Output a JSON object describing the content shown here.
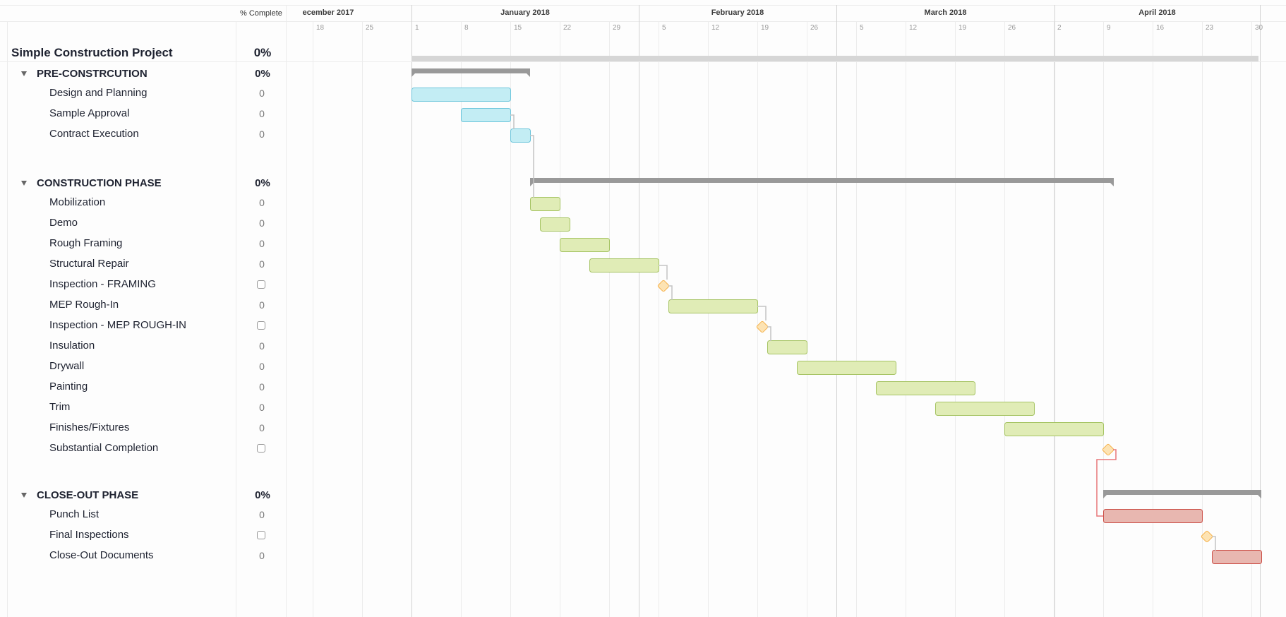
{
  "header": {
    "percent_complete_label": "% Complete",
    "months": [
      "ecember 2017",
      "January 2018",
      "February 2018",
      "March 2018",
      "April 2018"
    ],
    "days": [
      "18",
      "25",
      "1",
      "8",
      "15",
      "22",
      "29",
      "5",
      "12",
      "19",
      "26",
      "5",
      "12",
      "19",
      "26",
      "2",
      "9",
      "16",
      "23",
      "30"
    ]
  },
  "project": {
    "title": "Simple Construction Project",
    "percent": "0%"
  },
  "phases": [
    {
      "title": "PRE-CONSTRCUTION",
      "percent": "0%",
      "tasks": [
        {
          "name": "Design and Planning",
          "complete": "0"
        },
        {
          "name": "Sample Approval",
          "complete": "0"
        },
        {
          "name": "Contract Execution",
          "complete": "0"
        }
      ]
    },
    {
      "title": "CONSTRUCTION PHASE",
      "percent": "0%",
      "tasks": [
        {
          "name": "Mobilization",
          "complete": "0"
        },
        {
          "name": "Demo",
          "complete": "0"
        },
        {
          "name": "Rough Framing",
          "complete": "0"
        },
        {
          "name": "Structural Repair",
          "complete": "0"
        },
        {
          "name": "Inspection - FRAMING",
          "complete": "checkbox"
        },
        {
          "name": "MEP Rough-In",
          "complete": "0"
        },
        {
          "name": "Inspection - MEP ROUGH-IN",
          "complete": "checkbox"
        },
        {
          "name": "Insulation",
          "complete": "0"
        },
        {
          "name": "Drywall",
          "complete": "0"
        },
        {
          "name": "Painting",
          "complete": "0"
        },
        {
          "name": "Trim",
          "complete": "0"
        },
        {
          "name": "Finishes/Fixtures",
          "complete": "0"
        },
        {
          "name": "Substantial Completion",
          "complete": "checkbox"
        }
      ]
    },
    {
      "title": "CLOSE-OUT PHASE",
      "percent": "0%",
      "tasks": [
        {
          "name": "Punch List",
          "complete": "0"
        },
        {
          "name": "Final Inspections",
          "complete": "checkbox"
        },
        {
          "name": "Close-Out Documents",
          "complete": "0"
        }
      ]
    }
  ],
  "colors": {
    "project_bar": "#d6d6d6",
    "summary_bar": "#999999",
    "pre_fill": "#c3edf4",
    "pre_stroke": "#6cc5db",
    "con_fill": "#e0ecb6",
    "con_stroke": "#a6c464",
    "close_fill": "#e8b7b0",
    "close_stroke": "#cc5048",
    "milestone_fill": "#fde3b3",
    "milestone_stroke": "#f5b14a",
    "connector": "#c4c4c4",
    "critical_connector": "#e8767a"
  },
  "chart_data": {
    "type": "gantt",
    "title": "Simple Construction Project",
    "x_unit": "days from 2018-01-01",
    "x_range": [
      "2017-12-11",
      "2018-05-02"
    ],
    "rows": [
      {
        "name": "Simple Construction Project",
        "kind": "project",
        "start": 0,
        "end": 120
      },
      {
        "name": "PRE-CONSTRCUTION",
        "kind": "summary",
        "start": 0,
        "end": 16.8
      },
      {
        "name": "Design and Planning",
        "kind": "task",
        "phase": "pre",
        "start": 0,
        "end": 14
      },
      {
        "name": "Sample Approval",
        "kind": "task",
        "phase": "pre",
        "start": 7,
        "end": 14
      },
      {
        "name": "Contract Execution",
        "kind": "task",
        "phase": "pre",
        "start": 14,
        "end": 16.8
      },
      {
        "name": "CONSTRUCTION PHASE",
        "kind": "summary",
        "start": 16.8,
        "end": 99.5
      },
      {
        "name": "Mobilization",
        "kind": "task",
        "phase": "con",
        "start": 16.8,
        "end": 21
      },
      {
        "name": "Demo",
        "kind": "task",
        "phase": "con",
        "start": 18.2,
        "end": 22.4
      },
      {
        "name": "Rough Framing",
        "kind": "task",
        "phase": "con",
        "start": 21,
        "end": 28
      },
      {
        "name": "Structural Repair",
        "kind": "task",
        "phase": "con",
        "start": 25.2,
        "end": 35
      },
      {
        "name": "Inspection - FRAMING",
        "kind": "milestone",
        "at": 35.7
      },
      {
        "name": "MEP Rough-In",
        "kind": "task",
        "phase": "con",
        "start": 36.4,
        "end": 49
      },
      {
        "name": "Inspection - MEP ROUGH-IN",
        "kind": "milestone",
        "at": 49.7
      },
      {
        "name": "Insulation",
        "kind": "task",
        "phase": "con",
        "start": 50.4,
        "end": 56
      },
      {
        "name": "Drywall",
        "kind": "task",
        "phase": "con",
        "start": 54.6,
        "end": 68.6
      },
      {
        "name": "Painting",
        "kind": "task",
        "phase": "con",
        "start": 65.8,
        "end": 79.8
      },
      {
        "name": "Trim",
        "kind": "task",
        "phase": "con",
        "start": 74.2,
        "end": 88.2
      },
      {
        "name": "Finishes/Fixtures",
        "kind": "task",
        "phase": "con",
        "start": 84,
        "end": 98
      },
      {
        "name": "Substantial Completion",
        "kind": "milestone",
        "at": 98.7
      },
      {
        "name": "CLOSE-OUT PHASE",
        "kind": "summary",
        "start": 98,
        "end": 120.4
      },
      {
        "name": "Punch List",
        "kind": "task",
        "phase": "close",
        "start": 98,
        "end": 112
      },
      {
        "name": "Final Inspections",
        "kind": "milestone",
        "at": 112.7
      },
      {
        "name": "Close-Out Documents",
        "kind": "task",
        "phase": "close",
        "start": 113.4,
        "end": 120.4
      }
    ],
    "dependencies": [
      {
        "from": "Sample Approval",
        "to": "Contract Execution"
      },
      {
        "from": "Contract Execution",
        "to": "Mobilization"
      },
      {
        "from": "Structural Repair",
        "to": "Inspection - FRAMING"
      },
      {
        "from": "Inspection - FRAMING",
        "to": "MEP Rough-In"
      },
      {
        "from": "MEP Rough-In",
        "to": "Inspection - MEP ROUGH-IN"
      },
      {
        "from": "Inspection - MEP ROUGH-IN",
        "to": "Insulation"
      },
      {
        "from": "Substantial Completion",
        "to": "Punch List",
        "critical": true
      },
      {
        "from": "Final Inspections",
        "to": "Close-Out Documents"
      }
    ]
  }
}
